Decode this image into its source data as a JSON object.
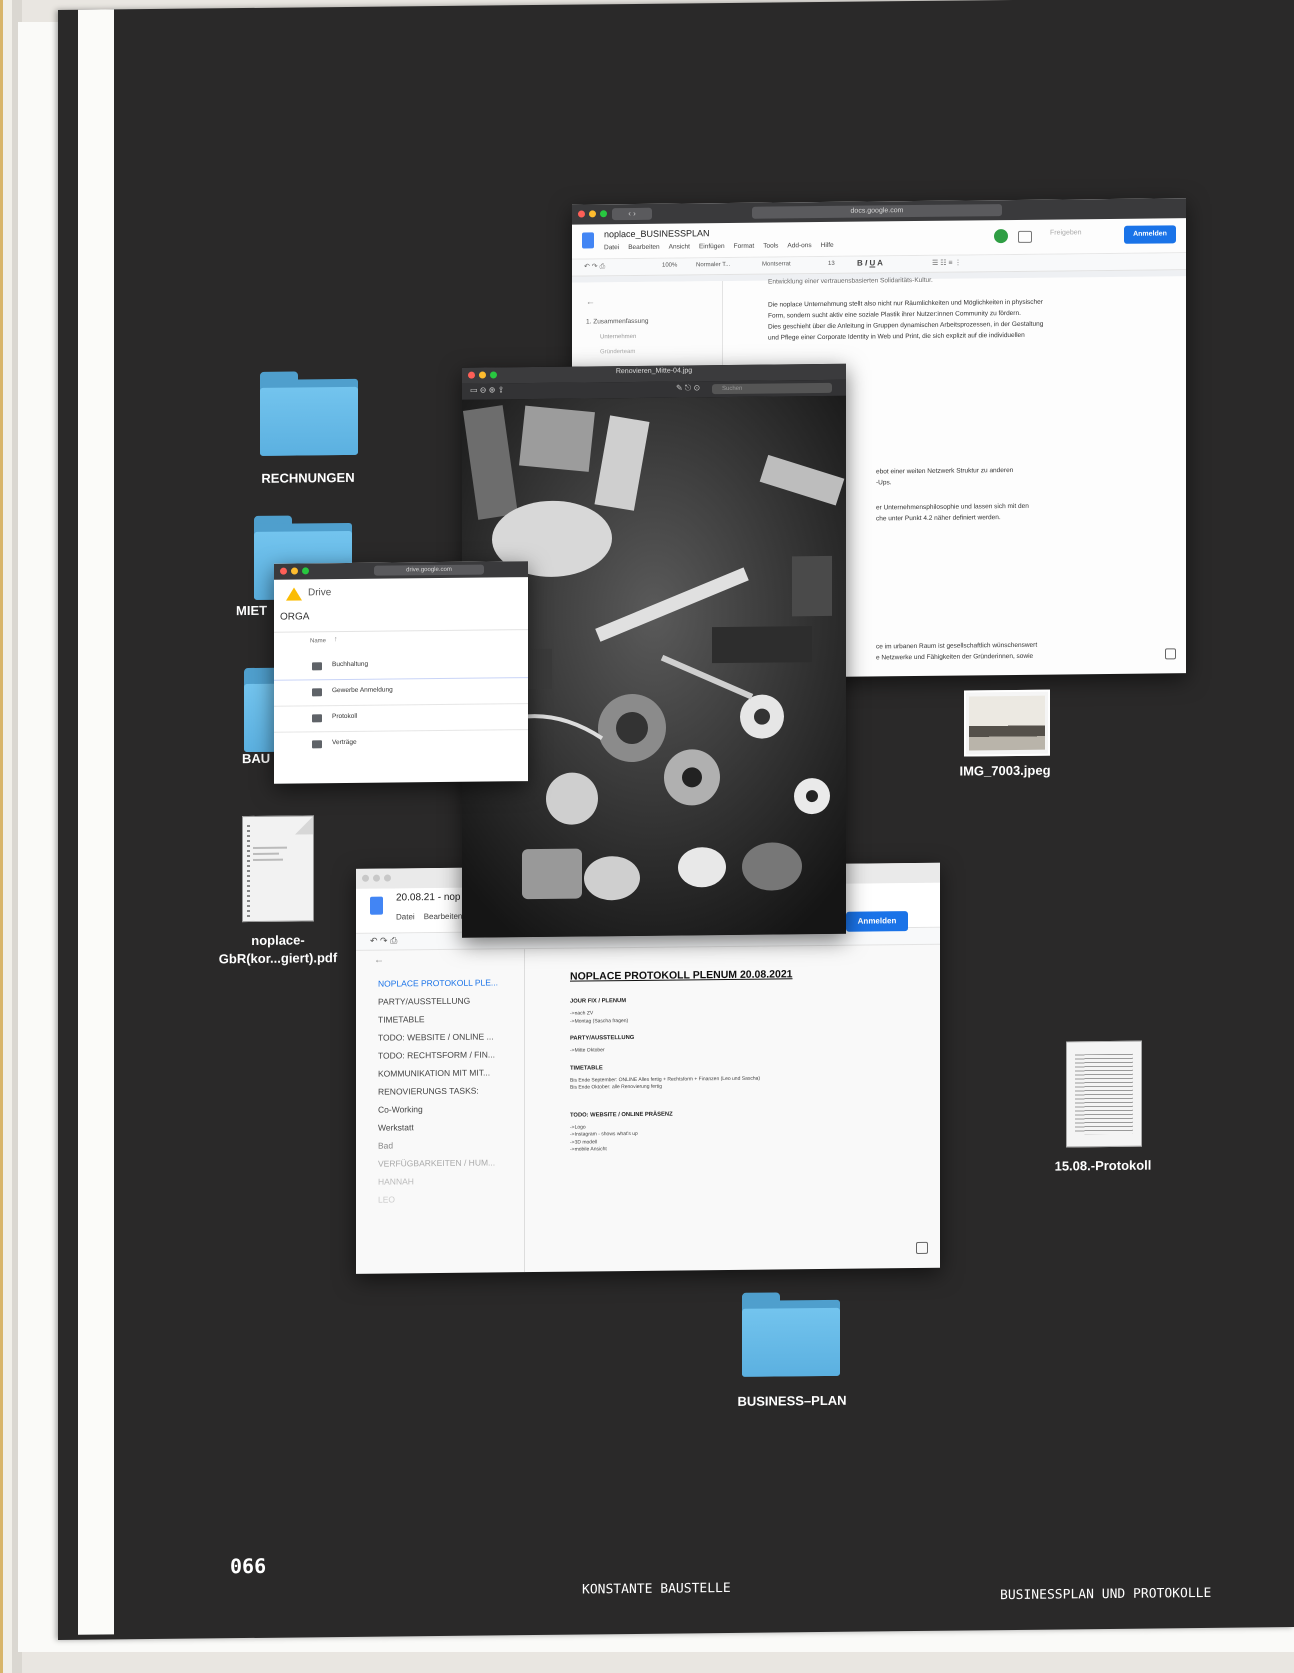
{
  "page_number": "066",
  "footer": {
    "center": "KONSTANTE BAUSTELLE",
    "right": "BUSINESSPLAN UND PROTOKOLLE"
  },
  "folders": {
    "rechnungen": "RECHNUNGEN",
    "miete": "MIET",
    "bau": "BAU",
    "business_plan": "BUSINESS–PLAN"
  },
  "files": {
    "pdf": "noplace-\nGbR(kor...giert).pdf",
    "image": "IMG_7003.jpeg",
    "protokoll": "15.08.-Protokoll"
  },
  "docs_window": {
    "url": "docs.google.com",
    "title": "noplace_BUSINESSPLAN",
    "menu": [
      "Datei",
      "Bearbeiten",
      "Ansicht",
      "Einfügen",
      "Format",
      "Tools",
      "Add-ons",
      "Hilfe"
    ],
    "share_label": "Freigeben",
    "signin_label": "Anmelden",
    "toolbar": {
      "zoom": "100%",
      "style": "Normaler T...",
      "font": "Montserrat",
      "size": "13"
    },
    "outline": [
      "1. Zusammenfassung",
      "Unternehmen",
      "Gründerteam"
    ],
    "cut_line": "Entwicklung einer vertrauensbasierten Solidaritäts-Kultur.",
    "paragraph": [
      "Die noplace Unternehmung stellt also nicht nur Räumlichkeiten und Möglichkeiten in physischer",
      "Form, sondern sucht aktiv eine soziale Plastik ihrer Nutzer:innen Community zu fördern.",
      "Dies geschieht über die Anleitung in Gruppen dynamischen Arbeitsprozessen, in der Gestaltung",
      "und Pflege einer Corporate Identity in Web und Print, die sich explizit auf die individuellen"
    ],
    "fragments": [
      "ebot einer weiten Netzwerk Struktur zu anderen",
      "-Ups.",
      "er Unternehmensphilosophie und lassen sich mit den",
      "che unter Punkt 4.2 näher definiert werden.",
      "ce im urbanen Raum ist gesellschaftlich wünschenswert",
      "e Netzwerke und Fähigkeiten der Gründerinnen, sowie"
    ]
  },
  "image_window": {
    "title": "Renovieren_Mitte-04.jpg",
    "search": "Suchen"
  },
  "drive_window": {
    "url": "drive.google.com",
    "app": "Drive",
    "folder": "ORGA",
    "column": "Name",
    "items": [
      "Buchhaltung",
      "Gewerbe Anmeldung",
      "Protokoll",
      "Verträge"
    ]
  },
  "protokoll_window": {
    "title": "20.08.21 - nop",
    "menu": [
      "Datei",
      "Bearbeiten"
    ],
    "signin_label": "Anmelden",
    "outline": [
      "NOPLACE PROTOKOLL PLE...",
      "PARTY/AUSSTELLUNG",
      "TIMETABLE",
      "TODO: WEBSITE / ONLINE ...",
      "TODO: RECHTSFORM / FIN...",
      "KOMMUNIKATION MIT MIT...",
      "RENOVIERUNGS TASKS:",
      "Co-Working",
      "Werkstatt",
      "Bad",
      "VERFÜGBARKEITEN / HUM...",
      "HANNAH",
      "LEO"
    ],
    "doc_title": "NOPLACE PROTOKOLL PLENUM 20.08.2021",
    "sections": [
      {
        "h": "JOUR FIX / PLENUM",
        "lines": [
          "->nach ZV",
          "->Montag (Sascha fragen)"
        ]
      },
      {
        "h": "PARTY/AUSSTELLUNG",
        "lines": [
          "->Mitte Oktober"
        ]
      },
      {
        "h": "TIMETABLE",
        "lines": [
          "Bis Ende September: ONLINE Alles fertig + Rechtsform + Finanzen (Leo und Sascha)",
          "Bis Ende Oktober: alle Renovierung fertig"
        ]
      },
      {
        "h": "TODO: WEBSITE / ONLINE PRÄSENZ",
        "lines": [
          "->Logo",
          "->Instagram - shows what's up",
          "->3D modell",
          "->mobile Ansicht"
        ]
      }
    ]
  }
}
